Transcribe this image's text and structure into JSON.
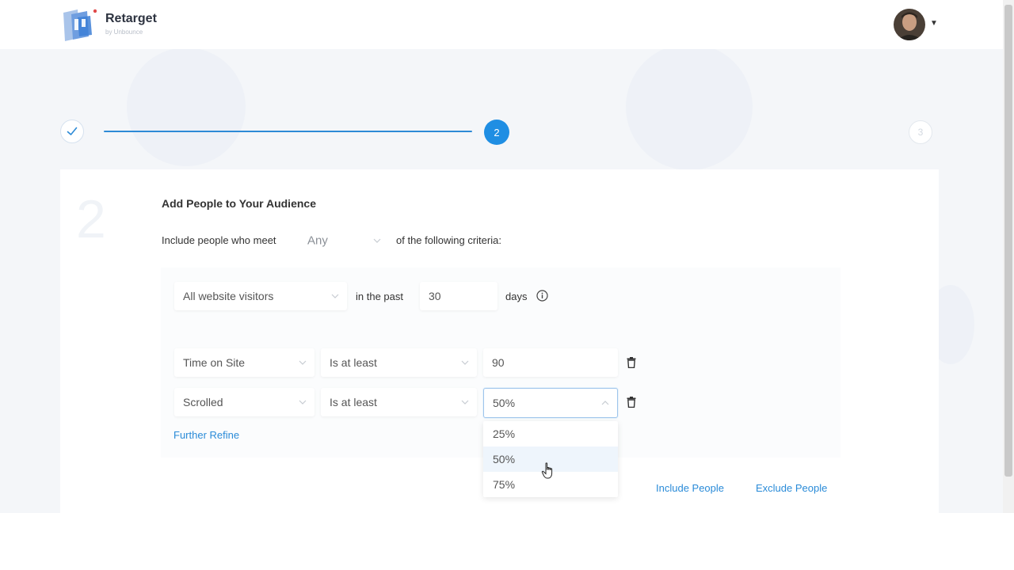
{
  "header": {
    "brand_name": "Retarget",
    "brand_sub": "by Unbounce"
  },
  "stepper": {
    "active_step": "2",
    "next_step": "3",
    "watermark_step": "2"
  },
  "audience": {
    "title": "Add People to Your Audience",
    "intro_before": "Include people who meet",
    "match_select": "Any",
    "intro_after": "of the following criteria:",
    "source_select": "All website visitors",
    "in_the_past_label": "in the past",
    "days_value": "30",
    "days_label": "days",
    "rules": [
      {
        "field": "Time on Site",
        "operator": "Is at least",
        "value": "90"
      },
      {
        "field": "Scrolled",
        "operator": "Is at least",
        "value": "50%"
      }
    ],
    "scroll_options": [
      "25%",
      "50%",
      "75%"
    ],
    "selected_option": "50%",
    "further_refine": "Further Refine",
    "include_people": "Include People",
    "exclude_people": "Exclude People"
  },
  "colors": {
    "accent": "#1f8ee3",
    "link": "#2a8bd8",
    "page_bg": "#f4f6f9"
  },
  "icons": [
    "logo-icon",
    "check-icon",
    "info-icon",
    "trash-icon",
    "chevron-down-icon",
    "chevron-up-icon",
    "caret-down-icon",
    "hand-cursor-icon"
  ]
}
